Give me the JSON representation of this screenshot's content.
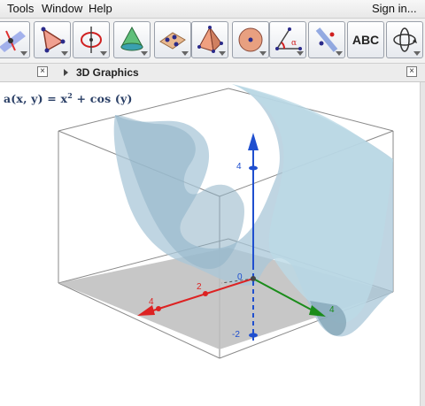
{
  "menubar": {
    "items": [
      "Tools",
      "Window",
      "Help"
    ],
    "sign_in": "Sign in..."
  },
  "toolbar": {
    "tools": [
      {
        "name": "move-graphic-view-tool"
      },
      {
        "name": "polygon-tool"
      },
      {
        "name": "circle-axis-tool"
      },
      {
        "name": "cone-tool"
      },
      {
        "name": "plane-points-tool"
      },
      {
        "name": "pyramid-tool"
      },
      {
        "name": "sphere-tool"
      },
      {
        "name": "angle-tool"
      },
      {
        "name": "reflect-plane-tool"
      },
      {
        "name": "text-tool",
        "label": "ABC"
      },
      {
        "name": "rotate-view-tool"
      }
    ]
  },
  "tabs": {
    "left_close": "×",
    "graphics_title": "3D Graphics",
    "right_close": "×"
  },
  "algebra": {
    "formula_lhs": "a(x, y) = x",
    "formula_exp": "2",
    "formula_rhs": "+ cos (y)"
  },
  "axes": {
    "z_labels": [
      "4",
      "-2"
    ],
    "x_labels": [
      "4",
      "2"
    ],
    "y_labels": [
      "4"
    ],
    "origin": "0",
    "x_color": "#dd2222",
    "y_color": "#1a8c1a",
    "z_color": "#1f4fcf"
  },
  "colors": {
    "surface": "#a9c7d8",
    "plane": "#bdbdbd",
    "box": "#8a8a8a"
  }
}
